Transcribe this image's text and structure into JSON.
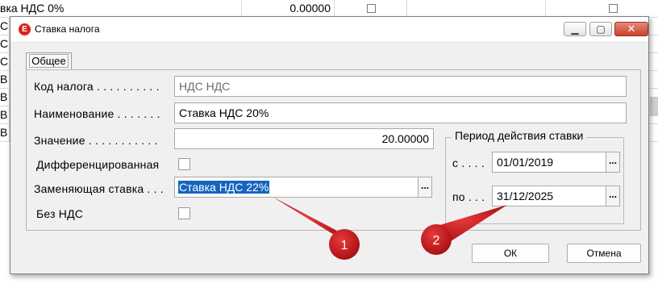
{
  "background_table": {
    "first_row_label": "вка НДС 0%",
    "first_row_value": "0.00000",
    "row_labels": [
      "С",
      "С",
      "С",
      "В",
      "В",
      "В",
      "В"
    ]
  },
  "dialog": {
    "title": "Ставка налога",
    "controls": {
      "minimize": "▁",
      "maximize": "▢",
      "close": "✕"
    },
    "tab_label": "Общее",
    "fields": {
      "code_label": "Код налога . . . . . . . . . .",
      "code_value": "НДС НДС",
      "name_label": "Наименование . . . . . . .",
      "name_value": "Ставка НДС 20%",
      "value_label": "Значение . . . . . . . . . . .",
      "value_value": "20.00000",
      "diff_label": "Дифференцированная",
      "replace_label": "Заменяющая ставка . . .",
      "replace_value": "Ставка НДС 22%",
      "novat_label": "Без НДС"
    },
    "period": {
      "title": "Период действия ставки",
      "from_label": "с . . . .",
      "from_value": "01/01/2019",
      "to_label": "по . . .",
      "to_value": "31/12/2025"
    },
    "ellipsis": "...",
    "buttons": {
      "ok": "ОК",
      "cancel": "Отмена"
    }
  },
  "annotations": [
    {
      "label": "1",
      "color": "#c0121a"
    },
    {
      "label": "2",
      "color": "#c0121a"
    }
  ]
}
